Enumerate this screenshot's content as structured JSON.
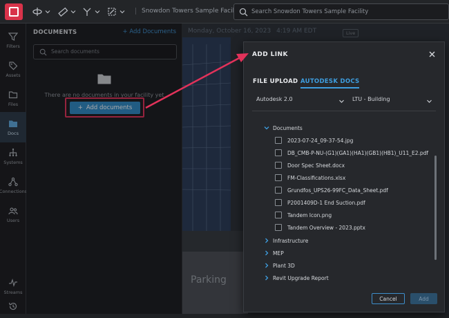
{
  "topbar": {
    "facility_name": "Snowdon Towers Sample Facility",
    "search_placeholder": "Search Snowdon Towers Sample Facility"
  },
  "leftnav": {
    "items": [
      {
        "label": "Filters",
        "icon": "filter-icon"
      },
      {
        "label": "Assets",
        "icon": "tag-icon"
      },
      {
        "label": "Files",
        "icon": "folder-icon"
      },
      {
        "label": "Docs",
        "icon": "docs-icon",
        "active": true
      },
      {
        "label": "Systems",
        "icon": "hierarchy-icon"
      },
      {
        "label": "Connections",
        "icon": "connections-icon"
      },
      {
        "label": "Users",
        "icon": "users-icon"
      },
      {
        "label": "Streams",
        "icon": "streams-icon"
      },
      {
        "label": "",
        "icon": "history-icon"
      }
    ]
  },
  "documents_panel": {
    "title": "DOCUMENTS",
    "add_link": "+ Add Documents",
    "search_placeholder": "Search documents",
    "empty_message": "There are no documents in your facility yet",
    "add_button": "Add documents"
  },
  "viewer": {
    "date": "Monday, October 16, 2023",
    "time": "4:19 AM EDT",
    "live_label": "Live",
    "sign_text": "Parking"
  },
  "dialog": {
    "title": "ADD LINK",
    "tabs": [
      {
        "label": "FILE UPLOAD",
        "active": false
      },
      {
        "label": "AUTODESK DOCS",
        "active": true
      }
    ],
    "hub_select": "Autodesk 2.0",
    "project_select": "LTU - Building",
    "tree": {
      "expanded_folder": "Documents",
      "files": [
        "2023-07-24_09-37-54.jpg",
        "DB_CMB-P-NU-(G1)(GA1)(HA1)(GB1)(HB1)_U11_E2.pdf",
        "Door Spec Sheet.docx",
        "FM-Classifications.xlsx",
        "Grundfos_UPS26-99FC_Data_Sheet.pdf",
        "P2001409D-1 End Suction.pdf",
        "Tandem Icon.png",
        "Tandem Overview - 2023.pptx"
      ],
      "collapsed_folders": [
        "Infrastructure",
        "MEP",
        "Plant 3D",
        "Revit Upgrade Report"
      ]
    },
    "cancel_button": "Cancel",
    "add_button": "Add"
  },
  "colors": {
    "accent": "#2f89c4",
    "highlight": "#e2325a",
    "logo": "#d8334a"
  }
}
